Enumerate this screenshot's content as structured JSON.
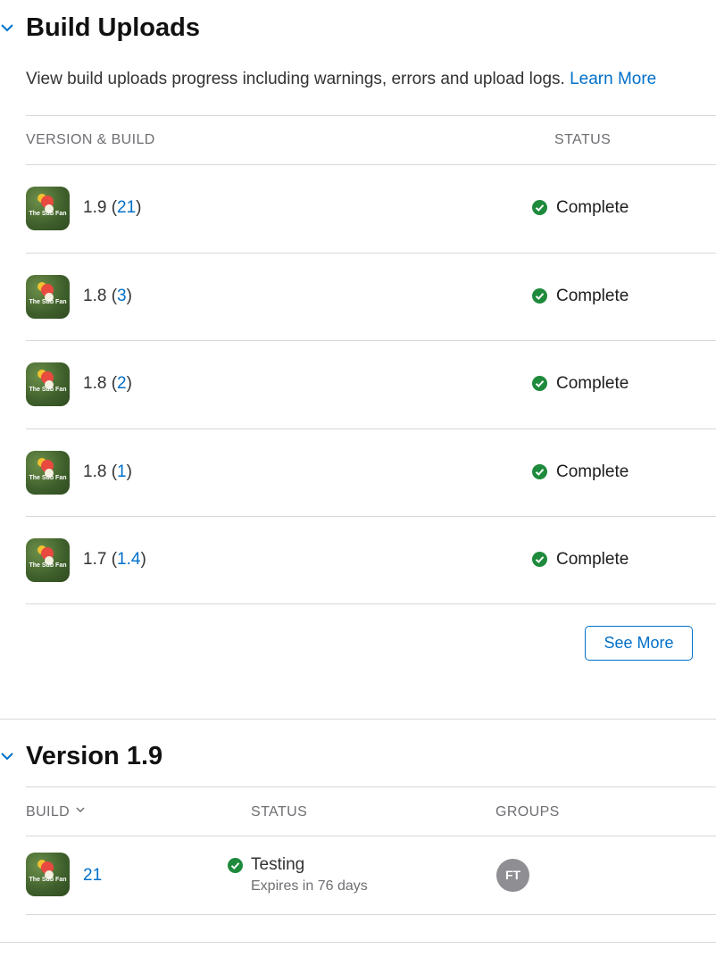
{
  "build_uploads": {
    "title": "Build Uploads",
    "description": "View build uploads progress including warnings, errors and upload logs.",
    "learn_more": "Learn More",
    "columns": {
      "version_build": "VERSION & BUILD",
      "status": "STATUS"
    },
    "rows": [
      {
        "version": "1.9",
        "build": "21",
        "status": "Complete"
      },
      {
        "version": "1.8",
        "build": "3",
        "status": "Complete"
      },
      {
        "version": "1.8",
        "build": "2",
        "status": "Complete"
      },
      {
        "version": "1.8",
        "build": "1",
        "status": "Complete"
      },
      {
        "version": "1.7",
        "build": "1.4",
        "status": "Complete"
      }
    ],
    "see_more": "See More"
  },
  "version_section": {
    "title": "Version 1.9",
    "columns": {
      "build": "BUILD",
      "status": "STATUS",
      "groups": "GROUPS"
    },
    "row": {
      "build": "21",
      "status": "Testing",
      "expires": "Expires in 76 days",
      "group_initials": "FT"
    }
  },
  "app_icon_text": "The Sub Fan",
  "colors": {
    "accent": "#0070c9",
    "success": "#1e8a3c"
  }
}
